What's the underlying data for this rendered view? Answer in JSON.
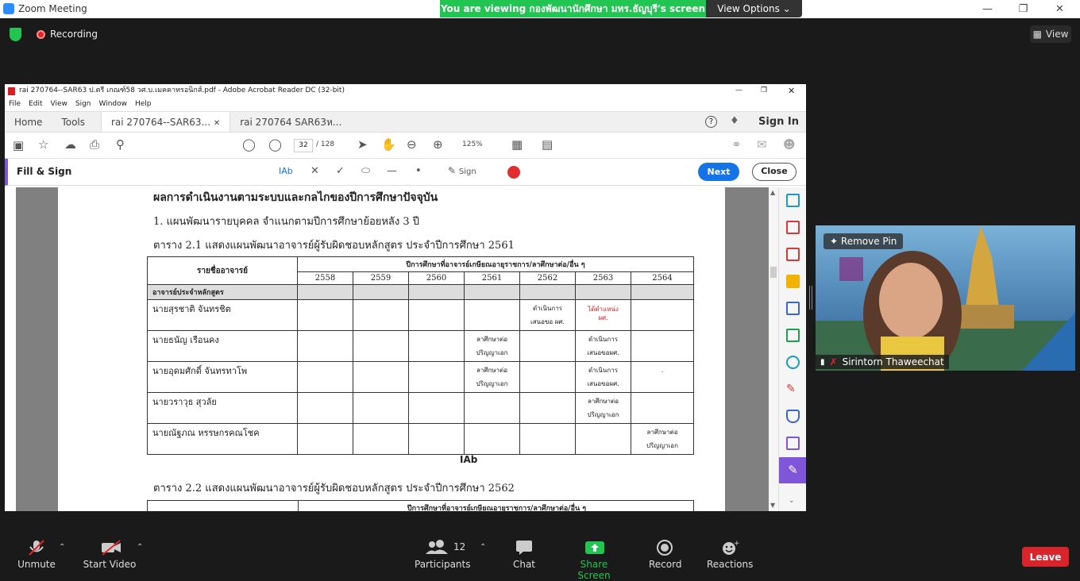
{
  "window": {
    "title": "Zoom Meeting"
  },
  "banner": {
    "text": "You are viewing กองพัฒนานักศึกษา มทร.ธัญบุรี's screen",
    "view_options": "View Options"
  },
  "status": {
    "recording": "Recording",
    "view": "View"
  },
  "acrobat": {
    "title": "rai 270764--SAR63 ป.ตรี เกณฑ์58 วศ.บ.เมคคาทรอนิกส์.pdf - Adobe Acrobat Reader DC (32-bit)",
    "menu": [
      "File",
      "Edit",
      "View",
      "Sign",
      "Window",
      "Help"
    ],
    "tabs": [
      "Home",
      "Tools",
      "rai 270764--SAR63...",
      "rai 270764 SAR63ห..."
    ],
    "sign_in": "Sign In",
    "page_current": "32",
    "page_total": "/ 128",
    "zoom": "125%",
    "fill_sign": "Fill & Sign",
    "sign": "Sign",
    "next": "Next",
    "close": "Close"
  },
  "document": {
    "heading": "ผลการดำเนินงานตามระบบและกลไกของปีการศึกษาปัจจุบัน",
    "subheading": "1.  แผนพัฒนารายบุคคล จำแนกตามปีการศึกษาย้อยหลัง 3 ปี",
    "table1_caption": "ตาราง 2.1 แสดงแผนพัฒนาอาจารย์ผู้รับผิดชอบหลักสูตร ประจำปีการศึกษา 2561",
    "table2_caption": "ตาราง 2.2 แสดงแผนพัฒนาอาจารย์ผู้รับผิดชอบหลักสูตร ประจำปีการศึกษา 2562",
    "col_name": "รายชื่ออาจารย์",
    "col_group": "ปีการศึกษาที่อาจารย์เกษียณอายุราชการ/ลาศึกษาต่อ/อื่น ๆ",
    "years": [
      "2558",
      "2559",
      "2560",
      "2561",
      "2562",
      "2563",
      "2564"
    ],
    "section": "อาจารย์ประจำหลักสูตร",
    "rows": [
      {
        "name": "นายสุรชาติ จันทรชิต",
        "cells": [
          "",
          "",
          "",
          "",
          "ดำเนินการ\nเสนอขอ ผศ.",
          "ได้ตำแหน่ง\nผศ.",
          ""
        ]
      },
      {
        "name": "นายธนัญ เรือนคง",
        "cells": [
          "",
          "",
          "",
          "ลาศึกษาต่อ\nปริญญาเอก",
          "",
          "ดำเนินการ\nเสนอขอผศ.",
          ""
        ]
      },
      {
        "name": "นายอุดมศักดิ์ จันทรทาโพ",
        "cells": [
          "",
          "",
          "",
          "ลาศึกษาต่อ\nปริญญาเอก",
          "",
          "ดำเนินการ\nเสนอขอผศ.",
          "."
        ]
      },
      {
        "name": "นายวราวุธ สุวลัย",
        "cells": [
          "",
          "",
          "",
          "",
          "",
          "ลาศึกษาต่อ\nปริญญาเอก",
          ""
        ]
      },
      {
        "name": "นายณัฐภณ หรรษกรคณโชค",
        "cells": [
          "",
          "",
          "",
          "",
          "",
          "",
          "ลาศึกษาต่อ\nปริญญาเอก"
        ]
      }
    ],
    "cursor_label": "IAb"
  },
  "video": {
    "remove_pin": "Remove Pin",
    "participant": "Sirintorn Thaweechat"
  },
  "bottom": {
    "unmute": "Unmute",
    "start_video": "Start Video",
    "participants": "Participants",
    "participants_count": "12",
    "chat": "Chat",
    "share_screen": "Share Screen",
    "record": "Record",
    "reactions": "Reactions",
    "leave": "Leave"
  },
  "colors": {
    "zoom_green": "#23c552",
    "zoom_blue": "#2d8cff",
    "leave_red": "#d8242b",
    "acrobat_blue": "#1473e6",
    "fill_sign_purple": "#7f56d9"
  }
}
